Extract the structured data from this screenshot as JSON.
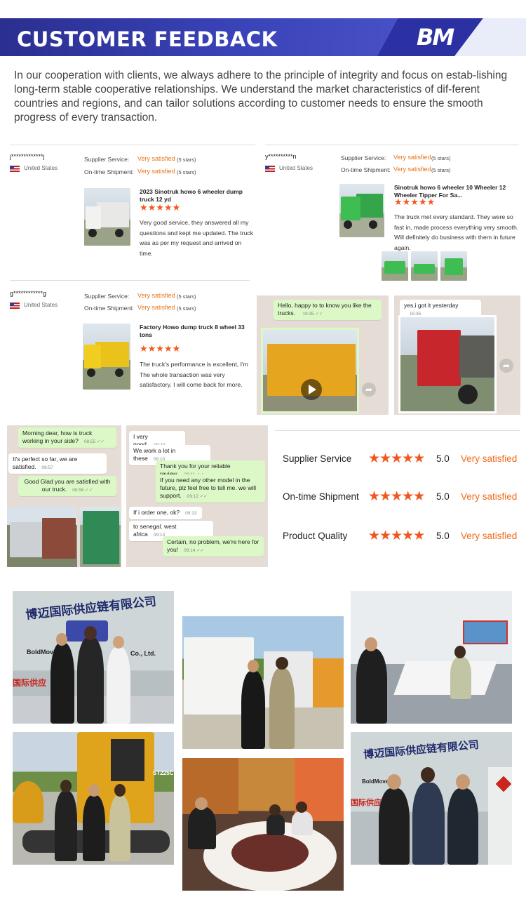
{
  "header": {
    "title": "CUSTOMER FEEDBACK",
    "logo_text": "BM"
  },
  "intro": "In our cooperation with clients, we always adhere to the principle of integrity and focus on estab-lishing long-term stable cooperative relationships. We understand the market characteristics of dif-ferent countries and regions, and can tailor solutions according to customer needs to ensure the smooth progress of every transaction.",
  "reviews": [
    {
      "user": "j*************j",
      "country": "United States",
      "supplier_label": "Supplier Service:",
      "supplier_value": "Very satisfied",
      "supplier_stars": "(5 stars)",
      "shipment_label": "On-time Shipment:",
      "shipment_value": "Very satisfied",
      "shipment_stars": "(5 stars)",
      "product": "2023 Sinotruk howo 6 wheeler dump truck 12 yd",
      "stars": "★★★★★",
      "text": "Very good service, they answered all my questions and kept me updated. The truck was as per my request and arrived on time."
    },
    {
      "user": "y**********n",
      "country": "United States",
      "supplier_label": "Supplier Service:",
      "supplier_value": "Very satisfied",
      "supplier_stars": "(5 stars)",
      "shipment_label": "On-time Shipment:",
      "shipment_value": "Very satisfied",
      "shipment_stars": "(5 stars)",
      "product": "Sinotruk howo 6 wheeler 10 Wheeler 12 Wheeler Tipper For Sa...",
      "stars": "★★★★★",
      "text": "The truck met every standard. They were so fast in, made process everything very smooth. Will definitely do business with them in future again."
    },
    {
      "user": "g************g",
      "country": "United States",
      "supplier_label": "Supplier Service:",
      "supplier_value": "Very satisfied",
      "supplier_stars": "(5 stars)",
      "shipment_label": "On-time Shipment:",
      "shipment_value": "Very satisfied",
      "shipment_stars": "(5 stars)",
      "product": "Factory Howo dump truck 8 wheel 33 tons",
      "stars": "★★★★★",
      "text": "The truck's performance is excellent, I'm The whole transaction was very satisfactory. I will come back for more."
    }
  ],
  "chat_top_left": {
    "msg": "Hello, happy to to know you like the trucks.",
    "time": "19:35 ✓✓"
  },
  "chat_top_right": {
    "msg": "yes,i got it yesterday",
    "time": "15:35"
  },
  "chat_a": [
    {
      "text": "Morning dear, how is truck working in your side?",
      "time": "08:55 ✓✓"
    },
    {
      "text": "It's perfect so far, we are satisfied.",
      "time": "08:57"
    },
    {
      "text": "Good Glad you are satisfied with our truck.",
      "time": "08:58 ✓✓"
    }
  ],
  "chat_b": [
    {
      "text": "I very good.",
      "time": "09:10"
    },
    {
      "text": "We work a lot in these",
      "time": "09:10"
    },
    {
      "text": "Thank you for your reliable review.",
      "time": "09:11 ✓✓"
    },
    {
      "text": "If you need any other model in the future, plz feel free to tell me. we will support.",
      "time": "09:12 ✓✓"
    },
    {
      "text": "If i order one, ok?",
      "time": "09:13"
    },
    {
      "text": "to senegal. west africa",
      "time": "09:13"
    },
    {
      "text": "Certain, no problem, we're here for you!",
      "time": "09:14 ✓✓"
    }
  ],
  "summary": [
    {
      "name": "Supplier Service",
      "stars": "★★★★★",
      "score": "5.0",
      "text": "Very satisfied"
    },
    {
      "name": "On-time Shipment",
      "stars": "★★★★★",
      "score": "5.0",
      "text": "Very satisfied"
    },
    {
      "name": "Product Quality",
      "stars": "★★★★★",
      "score": "5.0",
      "text": "Very satisfied"
    }
  ],
  "photos": {
    "sign_cn": "博迈国际供应链有限公司",
    "sign_en": "BoldMove",
    "sign_en_suffix": "Co., Ltd.",
    "sign_cn_short": "国际供应",
    "sign_bottom_cn": "博迈国际供应链有限公司",
    "sign_bottom_en": "BoldMove",
    "sign_bottom_short": "国际供应",
    "excavator_label": "ST225C"
  }
}
